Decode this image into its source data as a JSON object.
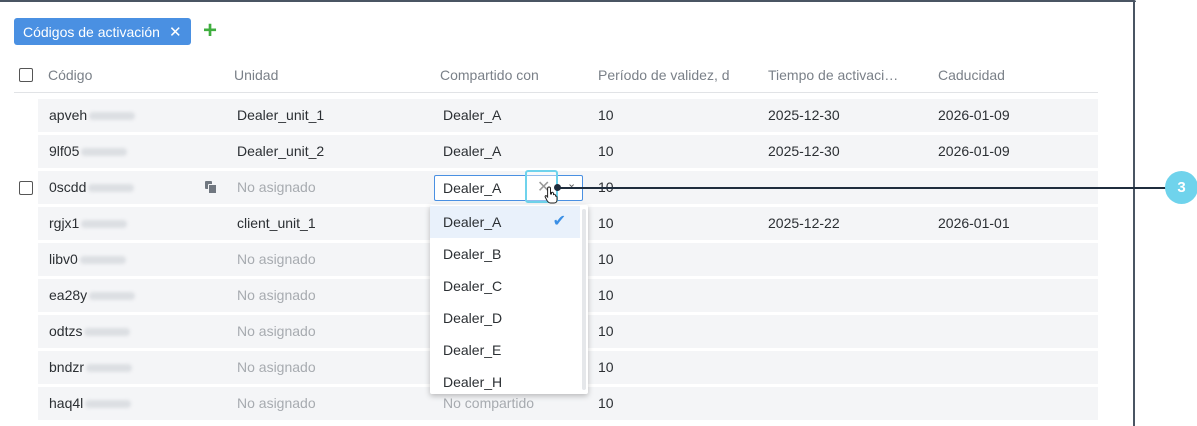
{
  "tab": {
    "label": "Códigos de activación",
    "close": "✕"
  },
  "add_label": "+",
  "headers": [
    "Código",
    "Unidad",
    "Compartido con",
    "Período de validez, d",
    "Tiempo de activaci…",
    "Caducidad"
  ],
  "rows": [
    {
      "code": "apveh",
      "unit": "Dealer_unit_1",
      "shared": "Dealer_A",
      "validity": "10",
      "activation": "2025-12-30",
      "expiry": "2026-01-09"
    },
    {
      "code": "9lf05",
      "unit": "Dealer_unit_2",
      "shared": "Dealer_A",
      "validity": "10",
      "activation": "2025-12-30",
      "expiry": "2026-01-09"
    },
    {
      "code": "0scdd",
      "unit": "No asignado",
      "shared": "",
      "validity": "10",
      "activation": "",
      "expiry": ""
    },
    {
      "code": "rgjx1",
      "unit": "client_unit_1",
      "shared": "",
      "validity": "10",
      "activation": "2025-12-22",
      "expiry": "2026-01-01"
    },
    {
      "code": "libv0",
      "unit": "No asignado",
      "shared": "",
      "validity": "10",
      "activation": "",
      "expiry": ""
    },
    {
      "code": "ea28y",
      "unit": "No asignado",
      "shared": "",
      "validity": "10",
      "activation": "",
      "expiry": ""
    },
    {
      "code": "odtzs",
      "unit": "No asignado",
      "shared": "",
      "validity": "10",
      "activation": "",
      "expiry": ""
    },
    {
      "code": "bndzr",
      "unit": "No asignado",
      "shared": "",
      "validity": "10",
      "activation": "",
      "expiry": ""
    },
    {
      "code": "haq4l",
      "unit": "No asignado",
      "shared": "No compartido",
      "validity": "10",
      "activation": "",
      "expiry": ""
    }
  ],
  "select": {
    "value": "Dealer_A",
    "clear": "✕",
    "chevron": "⌄"
  },
  "dropdown": {
    "options": [
      "Dealer_A",
      "Dealer_B",
      "Dealer_C",
      "Dealer_D",
      "Dealer_E",
      "Dealer_H"
    ],
    "check": "✔"
  },
  "annotation": {
    "number": "3"
  },
  "colors": {
    "accent": "#4a90e2",
    "add": "#3fae3f",
    "annotation": "#6fd3ec"
  }
}
